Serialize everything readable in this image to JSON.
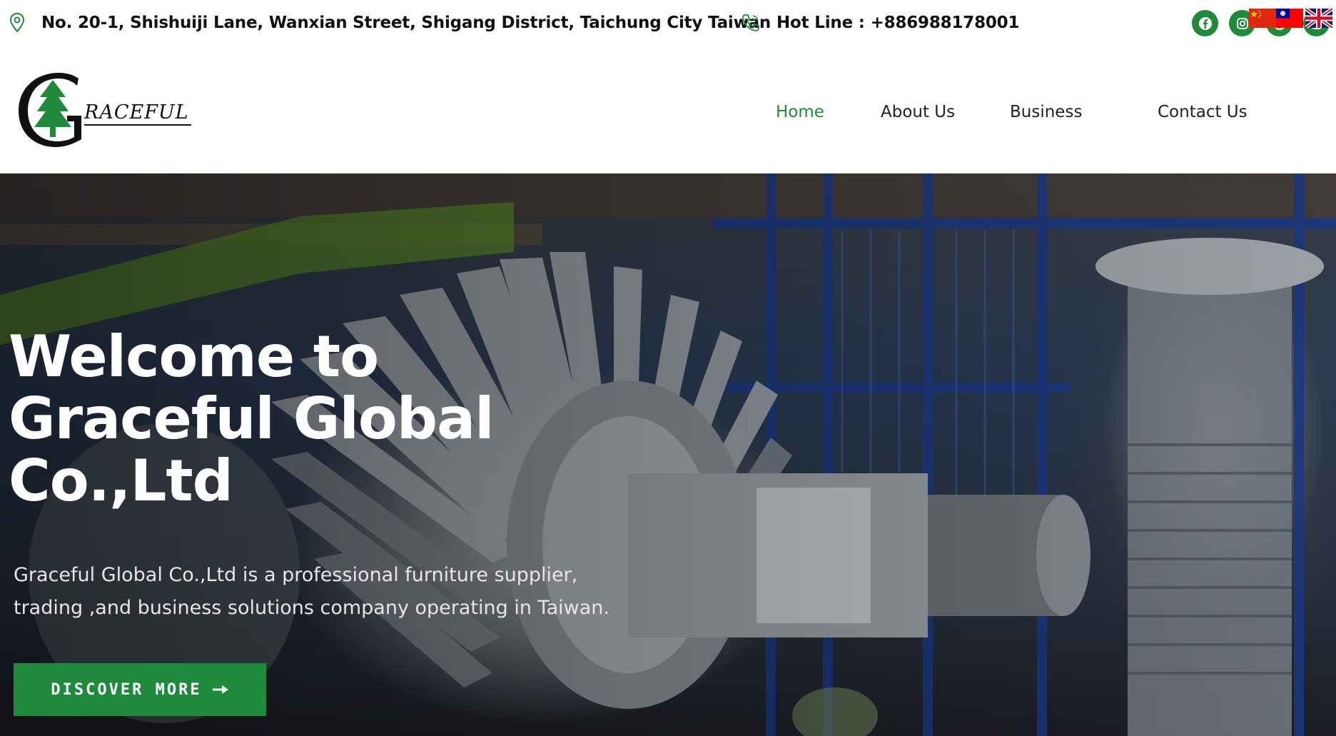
{
  "topbar": {
    "address_icon": "map-pin-icon",
    "address": "No. 20-1, Shishuiji Lane, Wanxian Street, Shigang District, Taichung City Taiwan",
    "phone_icon": "phone-icon",
    "hotline": "Hot Line : +886988178001",
    "socials": [
      {
        "name": "facebook-icon"
      },
      {
        "name": "instagram-icon"
      },
      {
        "name": "facebook-icon"
      },
      {
        "name": "instagram-icon"
      }
    ],
    "languages": [
      "Chinese (Simplified)",
      "Chinese (Traditional)",
      "English"
    ]
  },
  "logo": {
    "text": "RACEFUL",
    "initial": "G"
  },
  "nav": {
    "items": [
      "Home",
      "About Us",
      "Business",
      "Contact Us"
    ],
    "active": "Home"
  },
  "hero": {
    "title_lines": [
      "Welcome to",
      "Graceful Global",
      "Co.,Ltd"
    ],
    "description_lines": [
      "Graceful Global Co.,Ltd is a professional furniture supplier,",
      "trading ,and business solutions company operating in Taiwan."
    ],
    "cta_label": "DISCOVER MORE",
    "cta_icon": "arrow-right-icon"
  },
  "colors": {
    "brand_green": "#1f8a3b",
    "text_dark": "#111111",
    "hero_text": "#ffffff"
  }
}
